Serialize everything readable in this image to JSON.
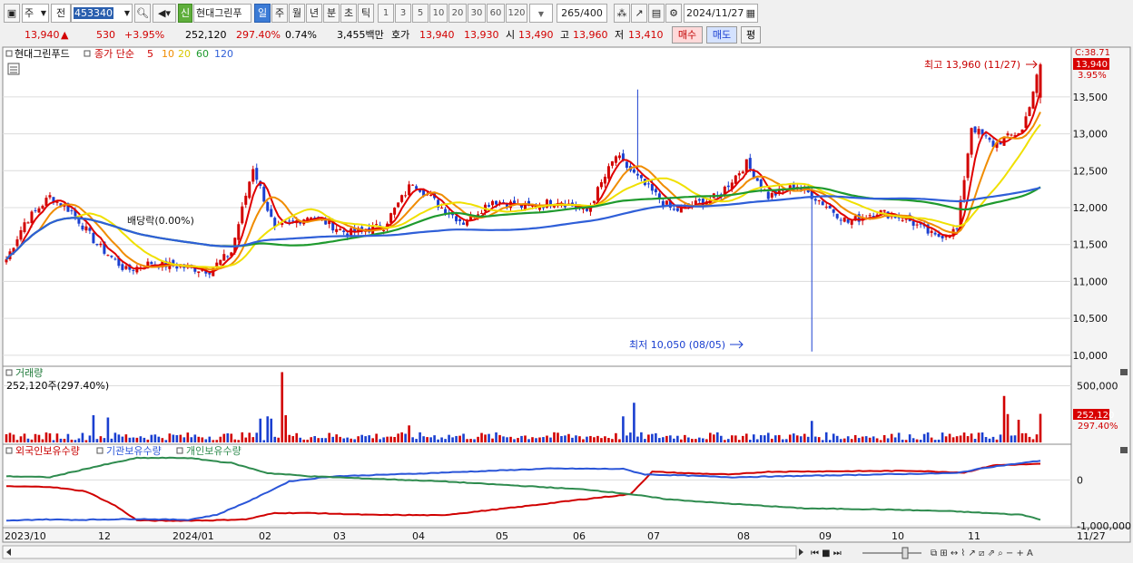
{
  "toolbar": {
    "type_select": "주",
    "market_select": "전",
    "code": "453340",
    "badge": "신",
    "stock_name": "현대그린푸",
    "periods": [
      "일",
      "주",
      "월",
      "년",
      "분",
      "초",
      "틱"
    ],
    "active_period": "일",
    "intervals": [
      "1",
      "3",
      "5",
      "10",
      "20",
      "30",
      "60",
      "120"
    ],
    "count": "265",
    "count_total": "/400",
    "date": "2024/11/27"
  },
  "quote": {
    "price": "13,940",
    "change_arrow": "▲",
    "change": "530",
    "change_pct": "+3.95%",
    "volume": "252,120",
    "volume_ratio": "297.40%",
    "turnover": "0.74%",
    "amount": "3,455백만",
    "bid_ask_label": "호가",
    "ask": "13,940",
    "bid": "13,930",
    "open_label": "시",
    "open": "13,490",
    "high_label": "고",
    "high": "13,960",
    "low_label": "저",
    "low": "13,410",
    "buy_button": "매수",
    "sell_button": "매도",
    "extra_button": "평"
  },
  "colors": {
    "up": "#d20000",
    "down": "#1a3fd0",
    "ma5": "#e00000",
    "ma10": "#f08c00",
    "ma20": "#f0e000",
    "ma60": "#1f9a2e",
    "ma120": "#2f5fd8",
    "foreign": "#d00000",
    "institution": "#2a55d8",
    "individual": "#2e8b4e"
  },
  "chart_data": [
    {
      "type": "candlestick",
      "title": "현대그린푸드",
      "legend": [
        "종가 단순",
        "5",
        "10",
        "20",
        "60",
        "120"
      ],
      "ylim": [
        9900,
        14100
      ],
      "y_ticks": [
        "13,500",
        "13,000",
        "12,500",
        "12,000",
        "11,500",
        "11,000",
        "10,500",
        "10,000"
      ],
      "y_right_top": "C:38.71",
      "price_tag": "13,940",
      "pct_tag": "3.95%",
      "annotations": {
        "high": "최고 13,960 (11/27)",
        "low": "최저 10,050 (08/05)",
        "dividend": "배당락(0.00%)"
      },
      "x_labels": [
        "2023/10",
        "12",
        "2024/01",
        "02",
        "03",
        "04",
        "05",
        "06",
        "07",
        "08",
        "09",
        "10",
        "11",
        "11/27"
      ],
      "close_anchors": [
        [
          0,
          11300
        ],
        [
          5,
          11800
        ],
        [
          12,
          12150
        ],
        [
          18,
          11950
        ],
        [
          25,
          11500
        ],
        [
          33,
          11150
        ],
        [
          40,
          11250
        ],
        [
          48,
          11200
        ],
        [
          56,
          11150
        ],
        [
          62,
          11400
        ],
        [
          68,
          12550
        ],
        [
          74,
          11700
        ],
        [
          84,
          11900
        ],
        [
          94,
          11650
        ],
        [
          104,
          11750
        ],
        [
          112,
          12350
        ],
        [
          120,
          12000
        ],
        [
          126,
          11800
        ],
        [
          134,
          12100
        ],
        [
          144,
          12000
        ],
        [
          152,
          12100
        ],
        [
          160,
          11950
        ],
        [
          168,
          12700
        ],
        [
          176,
          12300
        ],
        [
          184,
          11950
        ],
        [
          196,
          12150
        ],
        [
          204,
          12600
        ],
        [
          210,
          12150
        ],
        [
          218,
          12300
        ],
        [
          224,
          12100
        ],
        [
          232,
          11800
        ],
        [
          240,
          11950
        ],
        [
          248,
          11850
        ],
        [
          256,
          11600
        ],
        [
          262,
          11700
        ],
        [
          266,
          13100
        ],
        [
          272,
          12850
        ],
        [
          280,
          13050
        ],
        [
          285,
          13940
        ]
      ],
      "ma_periods": [
        5,
        10,
        20,
        60,
        120
      ]
    },
    {
      "type": "bar",
      "title": "거래량",
      "subtitle": "252,120주(297.40%)",
      "y_ticks": [
        "500,000"
      ],
      "ylim": [
        0,
        640000
      ],
      "last_value_tag": "252,120",
      "last_pct_tag": "297.40%",
      "spikes": [
        [
          24,
          240000
        ],
        [
          28,
          220000
        ],
        [
          70,
          210000
        ],
        [
          72,
          230000
        ],
        [
          73,
          210000
        ],
        [
          76,
          620000
        ],
        [
          77,
          240000
        ],
        [
          111,
          150000
        ],
        [
          170,
          230000
        ],
        [
          173,
          350000
        ],
        [
          222,
          190000
        ],
        [
          275,
          410000
        ],
        [
          276,
          250000
        ],
        [
          279,
          200000
        ],
        [
          285,
          252120
        ]
      ]
    },
    {
      "type": "line",
      "title": "외국인보유수량",
      "series": [
        {
          "name": "외국인보유수량",
          "values": [
            [
              0,
              -140000
            ],
            [
              12,
              -150000
            ],
            [
              22,
              -250000
            ],
            [
              30,
              -560000
            ],
            [
              36,
              -880000
            ],
            [
              44,
              -890000
            ],
            [
              56,
              -880000
            ],
            [
              66,
              -860000
            ],
            [
              74,
              -720000
            ],
            [
              84,
              -720000
            ],
            [
              100,
              -760000
            ],
            [
              120,
              -770000
            ],
            [
              140,
              -600000
            ],
            [
              158,
              -430000
            ],
            [
              172,
              -310000
            ],
            [
              178,
              180000
            ],
            [
              190,
              140000
            ],
            [
              200,
              120000
            ],
            [
              210,
              180000
            ],
            [
              230,
              190000
            ],
            [
              250,
              200000
            ],
            [
              264,
              160000
            ],
            [
              272,
              320000
            ],
            [
              285,
              350000
            ]
          ]
        },
        {
          "name": "기관보유수량",
          "values": [
            [
              0,
              -890000
            ],
            [
              10,
              -860000
            ],
            [
              20,
              -870000
            ],
            [
              36,
              -850000
            ],
            [
              50,
              -870000
            ],
            [
              58,
              -760000
            ],
            [
              68,
              -420000
            ],
            [
              78,
              -30000
            ],
            [
              90,
              80000
            ],
            [
              110,
              130000
            ],
            [
              130,
              190000
            ],
            [
              150,
              250000
            ],
            [
              170,
              240000
            ],
            [
              176,
              120000
            ],
            [
              186,
              100000
            ],
            [
              200,
              60000
            ],
            [
              220,
              90000
            ],
            [
              240,
              120000
            ],
            [
              262,
              150000
            ],
            [
              270,
              270000
            ],
            [
              285,
              420000
            ]
          ]
        },
        {
          "name": "개인보유수량",
          "values": [
            [
              0,
              80000
            ],
            [
              12,
              60000
            ],
            [
              24,
              280000
            ],
            [
              36,
              480000
            ],
            [
              50,
              480000
            ],
            [
              62,
              370000
            ],
            [
              72,
              150000
            ],
            [
              84,
              80000
            ],
            [
              100,
              30000
            ],
            [
              120,
              -30000
            ],
            [
              140,
              -120000
            ],
            [
              160,
              -210000
            ],
            [
              172,
              -310000
            ],
            [
              182,
              -420000
            ],
            [
              200,
              -520000
            ],
            [
              220,
              -620000
            ],
            [
              240,
              -640000
            ],
            [
              260,
              -680000
            ],
            [
              270,
              -720000
            ],
            [
              280,
              -760000
            ],
            [
              285,
              -860000
            ]
          ]
        }
      ],
      "y_ticks": [
        "0",
        "-1,000,000"
      ],
      "ylim": [
        -1000000,
        700000
      ]
    }
  ]
}
